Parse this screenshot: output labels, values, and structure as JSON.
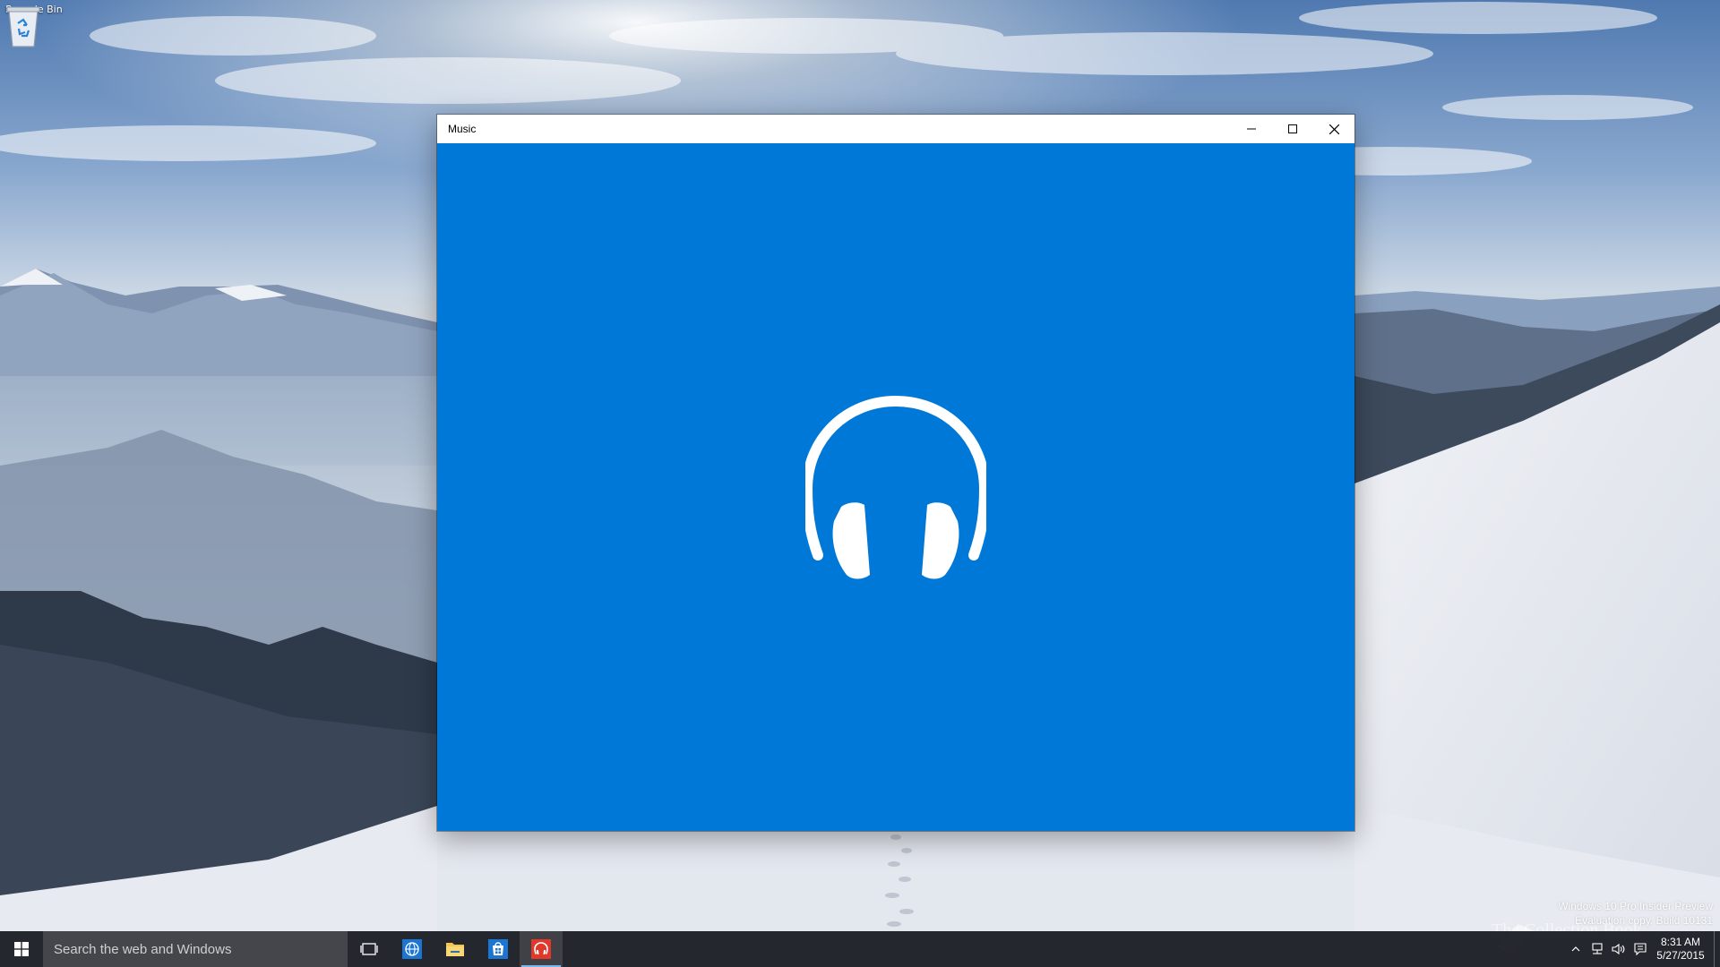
{
  "desktop": {
    "icons": [
      {
        "label": "Recycle Bin",
        "icon": "recycle-bin-icon"
      }
    ],
    "watermark": {
      "line1": "Windows 10 Pro Insider Preview",
      "line2": "Evaluation copy. Build 10131"
    },
    "brand": "The Collection Book"
  },
  "window": {
    "title": "Music",
    "controls": [
      "minimize-icon",
      "maximize-icon",
      "close-icon"
    ],
    "background": "#0078d7",
    "splash_icon": "headphones-icon"
  },
  "taskbar": {
    "search_placeholder": "Search the web and Windows",
    "pinned": [
      {
        "name": "task-view",
        "icon": "task-view-icon"
      },
      {
        "name": "browser",
        "icon": "globe-icon"
      },
      {
        "name": "file-explorer",
        "icon": "folder-icon"
      },
      {
        "name": "store",
        "icon": "store-icon"
      },
      {
        "name": "music",
        "icon": "headphones-icon",
        "active": true
      }
    ],
    "tray_icons": [
      "chevron-up-icon",
      "network-icon",
      "volume-icon",
      "action-center-icon"
    ],
    "clock": {
      "time": "8:31 AM",
      "date": "5/27/2015"
    }
  }
}
